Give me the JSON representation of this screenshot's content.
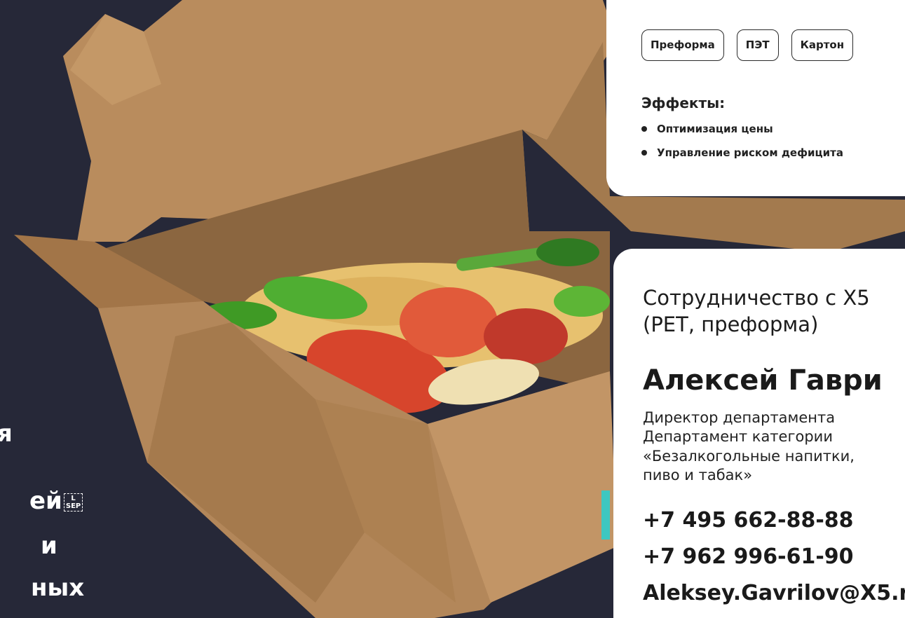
{
  "left_headline": {
    "line1": "я",
    "line2": "ей",
    "sep_top": "L",
    "sep_bottom": "SEP",
    "line3": "и",
    "line4": "ных"
  },
  "top_card": {
    "materials": [
      "Преформа",
      "ПЭТ",
      "Картон"
    ],
    "effects_title": "Эффекты:",
    "effects": [
      "Оптимизация цены",
      "Управление риском дефицита"
    ]
  },
  "contact_card": {
    "cooperation": "Сотрудничество с X5",
    "cooperation_sub": "(PET, преформа)",
    "name": "Алексей Гаври",
    "role_line1": "Директор департамента",
    "role_line2": "Департамент категории",
    "role_line3": "«Безалкогольные напитки,",
    "role_line4": "пиво и табак»",
    "phone1": "+7 495 662-88-88",
    "phone2": "+7 962 996-61-90",
    "email": "Aleksey.Gavrilov@X5.r"
  },
  "colors": {
    "background": "#262838",
    "card": "#ffffff",
    "kraft": "#b88a5a",
    "accent_teal": "#3ec7c0"
  }
}
